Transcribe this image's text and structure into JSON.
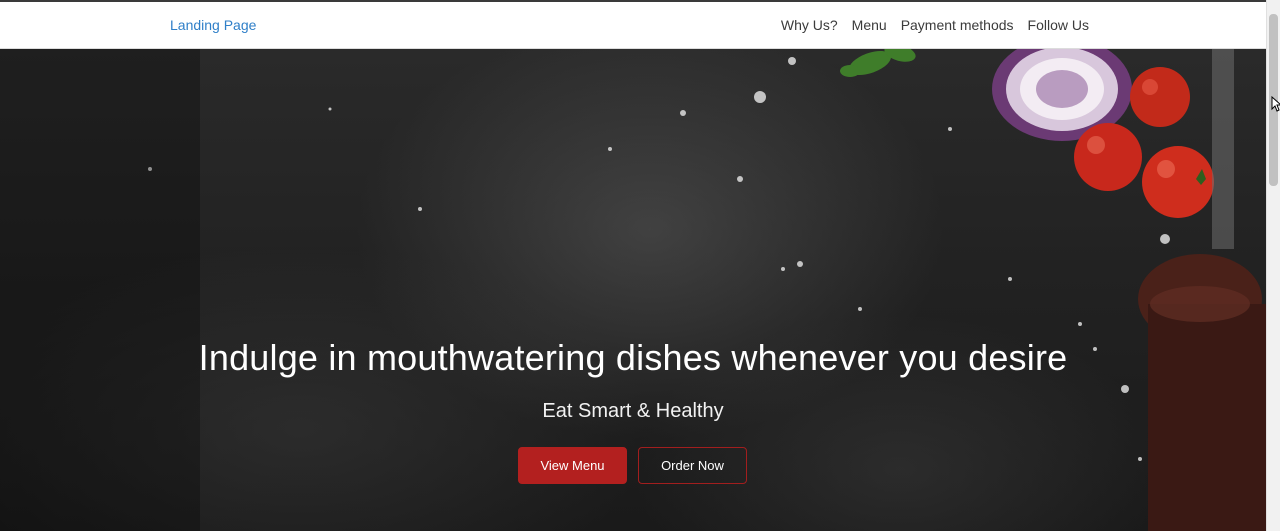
{
  "navbar": {
    "brand": "Landing Page",
    "links": [
      "Why Us?",
      "Menu",
      "Payment methods",
      "Follow Us"
    ]
  },
  "hero": {
    "title": "Indulge in mouthwatering dishes whenever you desire",
    "subtitle": "Eat Smart & Healthy",
    "primary_button": "View Menu",
    "secondary_button": "Order Now"
  },
  "colors": {
    "brand_link": "#2f7fc8",
    "accent_red": "#b3201f",
    "hero_dark": "#222222"
  }
}
